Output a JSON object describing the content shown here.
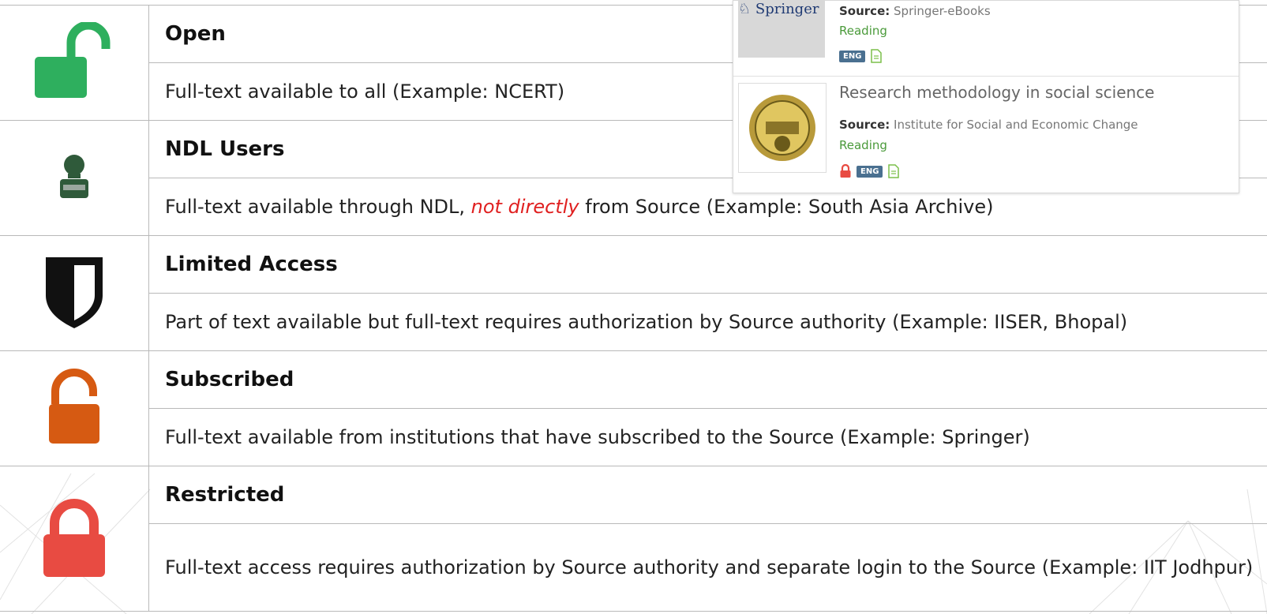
{
  "legend": [
    {
      "icon": "open-lock-icon",
      "title": "Open",
      "description": "Full-text available to all (Example: NCERT)"
    },
    {
      "icon": "ndl-user-icon",
      "title": "NDL Users",
      "description_parts": [
        "Full-text available through NDL, ",
        "not directly",
        " from Source (Example: South Asia Archive)"
      ]
    },
    {
      "icon": "shield-icon",
      "title": "Limited Access",
      "description": "Part of text available but full-text requires authorization by Source authority (Example: IISER, Bhopal)"
    },
    {
      "icon": "subscribed-lock-icon",
      "title": "Subscribed",
      "description": "Full-text available from institutions that have subscribed to the Source (Example: Springer)"
    },
    {
      "icon": "restricted-lock-icon",
      "title": "Restricted",
      "description": "Full-text access requires authorization by Source authority and separate login to the Source (Example: IIT Jodhpur)"
    }
  ],
  "panel": {
    "records": [
      {
        "logo": "Springer",
        "source_label": "Source:",
        "source": "Springer-eBooks",
        "type": "Reading",
        "lang": "ENG"
      },
      {
        "title": "Research methodology in social science",
        "source_label": "Source:",
        "source": "Institute for Social and Economic Change",
        "type": "Reading",
        "lang": "ENG"
      }
    ]
  },
  "colors": {
    "open": "#2eaf5e",
    "ndl": "#2f5a3a",
    "limited": "#111111",
    "subscribed": "#d65a12",
    "restricted": "#e84b42"
  }
}
